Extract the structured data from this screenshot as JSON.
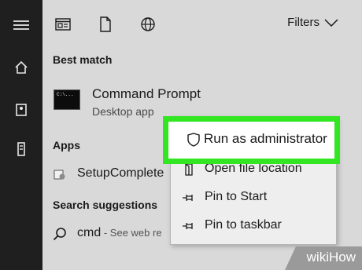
{
  "search_bar": {
    "filters_label": "Filters"
  },
  "sections": {
    "best_match": "Best match",
    "apps": "Apps",
    "search_suggestions": "Search suggestions"
  },
  "best_match": {
    "title": "Command Prompt",
    "subtitle": "Desktop app",
    "icon_text": "C:\\..."
  },
  "apps": [
    {
      "label": "SetupComplete"
    }
  ],
  "suggestions": [
    {
      "label": "cmd",
      "hint": " - See web re"
    }
  ],
  "context_menu": {
    "items": [
      {
        "label": "Run as administrator",
        "icon": "shield-icon"
      },
      {
        "label": "Open file location",
        "icon": "folder-icon"
      },
      {
        "label": "Pin to Start",
        "icon": "pin-icon"
      },
      {
        "label": "Pin to taskbar",
        "icon": "pin-icon"
      }
    ]
  },
  "watermark": "wikiHow",
  "colors": {
    "highlight": "#33e622",
    "rail": "#1f1f1f",
    "panel": "#d9d9d9"
  }
}
